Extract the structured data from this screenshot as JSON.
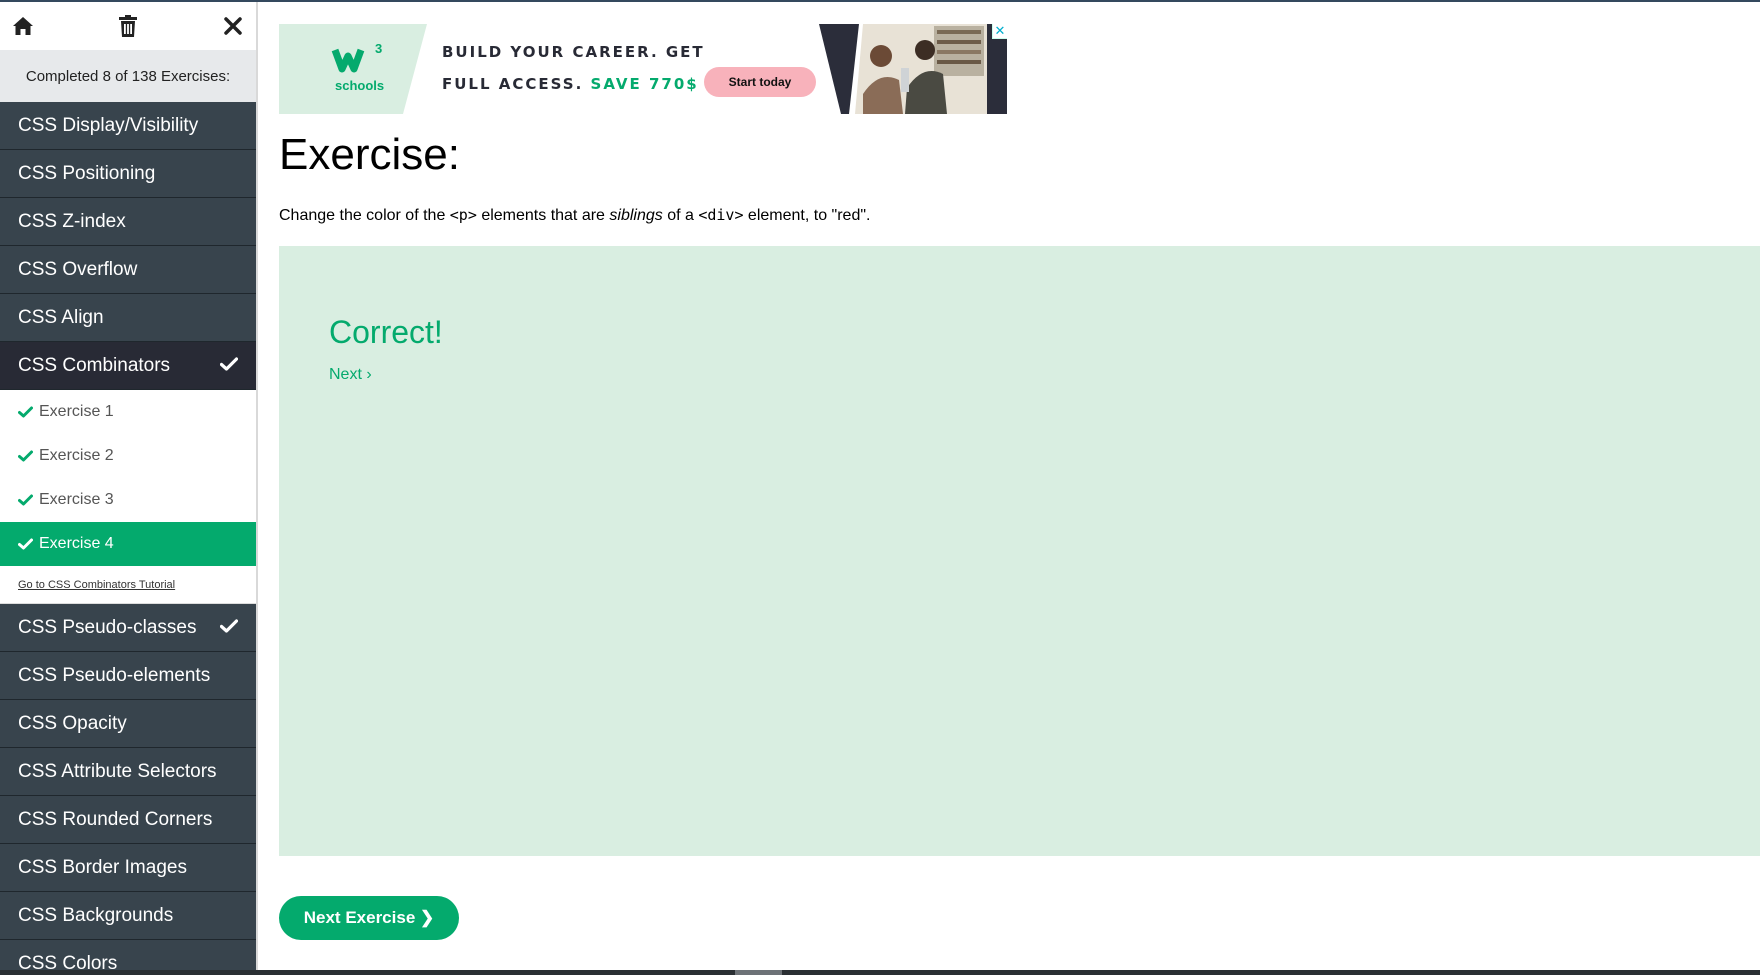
{
  "sidebar": {
    "progress_text": "Completed 8 of 138 Exercises:",
    "categories_top": [
      {
        "label": "CSS Display/Visibility"
      },
      {
        "label": "CSS Positioning"
      },
      {
        "label": "CSS Z-index"
      },
      {
        "label": "CSS Overflow"
      },
      {
        "label": "CSS Align"
      }
    ],
    "active_category": {
      "label": "CSS Combinators",
      "completed": true
    },
    "exercises": [
      {
        "label": "Exercise 1",
        "done": true
      },
      {
        "label": "Exercise 2",
        "done": true
      },
      {
        "label": "Exercise 3",
        "done": true
      },
      {
        "label": "Exercise 4",
        "done": true,
        "current": true
      }
    ],
    "tutorial_link": "Go to CSS Combinators Tutorial",
    "categories_bottom": [
      {
        "label": "CSS Pseudo-classes",
        "completed": true
      },
      {
        "label": "CSS Pseudo-elements"
      },
      {
        "label": "CSS Opacity"
      },
      {
        "label": "CSS Attribute Selectors"
      },
      {
        "label": "CSS Rounded Corners"
      },
      {
        "label": "CSS Border Images"
      },
      {
        "label": "CSS Backgrounds"
      },
      {
        "label": "CSS Colors"
      }
    ]
  },
  "ad": {
    "logo_text": "schools",
    "logo_sup": "3",
    "line1": "BUILD YOUR CAREER. GET",
    "line2": "FULL ACCESS.",
    "save_text": "SAVE 770$",
    "cta": "Start today",
    "close": "✕"
  },
  "exercise": {
    "title": "Exercise:",
    "desc_1": "Change the color of the ",
    "code_1": "<p>",
    "desc_2": " elements that are ",
    "emph": "siblings",
    "desc_3": " of a ",
    "code_2": "<div>",
    "desc_4": " element, to \"red\"."
  },
  "result": {
    "correct": "Correct!",
    "next_link": "Next ›"
  },
  "next_exercise_button": "Next Exercise ❯",
  "colors": {
    "accent": "#04aa6d",
    "sidebar_dark": "#38444d",
    "result_bg": "#d9eee1"
  }
}
